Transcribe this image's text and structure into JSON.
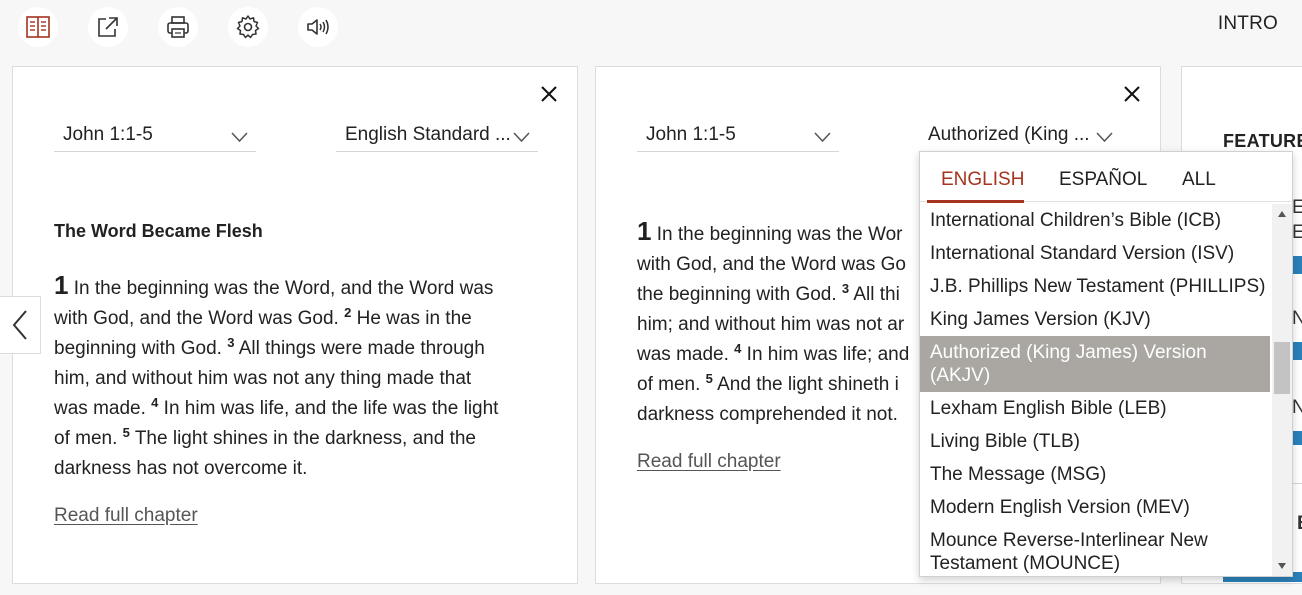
{
  "toolbar": {
    "buttons": [
      {
        "icon": "parallel-view-icon",
        "color": "#a5331f"
      },
      {
        "icon": "share-icon"
      },
      {
        "icon": "print-icon"
      },
      {
        "icon": "settings-icon"
      },
      {
        "icon": "audio-icon"
      }
    ],
    "intro_label": "INTRO"
  },
  "panel1": {
    "reference": "John 1:1-5",
    "version": "English Standard ...",
    "heading": "The Word Became Flesh",
    "lines": [
      [
        "1",
        " In the beginning was the Word, and the Word was"
      ],
      [
        "",
        "with God, and the Word was God. ",
        "2",
        " He was in the"
      ],
      [
        "",
        "beginning with God. ",
        "3",
        " All things were made through"
      ],
      [
        "",
        "him, and without him was not any thing made that"
      ],
      [
        "",
        "was made. ",
        "4",
        " In him was life, and the life was the light"
      ],
      [
        "",
        "of men. ",
        "5",
        " The light shines in the darkness, and the"
      ],
      [
        "",
        "darkness has not overcome it."
      ]
    ],
    "read_full": "Read full chapter"
  },
  "panel2": {
    "reference": "John 1:1-5",
    "version": "Authorized (King ...",
    "lines": [
      [
        "1",
        " In the beginning was the Wor"
      ],
      [
        "",
        "with God, and the Word was Go"
      ],
      [
        "",
        "the beginning with God. ",
        "3",
        " All thi"
      ],
      [
        "",
        "him; and without him was not ar"
      ],
      [
        "",
        "was made. ",
        "4",
        " In him was life; and"
      ],
      [
        "",
        "of men. ",
        "5",
        " And the light shineth i"
      ],
      [
        "",
        "darkness comprehended it not."
      ]
    ],
    "read_full": "Read full chapter"
  },
  "panel3": {
    "title": "FEATURE",
    "fragments": [
      "E",
      "E",
      "N",
      "N",
      "B"
    ]
  },
  "dropdown": {
    "tabs": [
      "ENGLISH",
      "ESPAÑOL",
      "ALL"
    ],
    "active_tab": "ENGLISH",
    "accent": "#a5331f",
    "items": [
      "International Children’s Bible (ICB)",
      "International Standard Version (ISV)",
      "J.B. Phillips New Testament (PHILLIPS)",
      "King James Version (KJV)",
      "Authorized (King James) Version (AKJV)",
      "Lexham English Bible (LEB)",
      "Living Bible (TLB)",
      "The Message (MSG)",
      "Modern English Version (MEV)",
      "Mounce Reverse-Interlinear New Testament (MOUNCE)"
    ],
    "selected": "Authorized (King James) Version (AKJV)",
    "selected_bg": "#aaa7a3"
  }
}
